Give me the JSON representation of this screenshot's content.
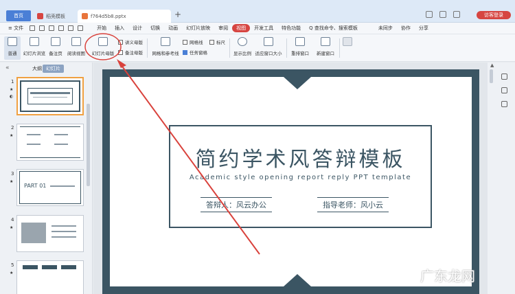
{
  "titlebar": {
    "tabs": [
      {
        "label": "首页"
      },
      {
        "label": "稻壳模板"
      },
      {
        "label": "f764d5b8.pptx"
      }
    ],
    "login_label": "访客登录"
  },
  "menubar": {
    "file_label": "≡ 文件",
    "items": [
      "开始",
      "插入",
      "设计",
      "切换",
      "动画",
      "幻灯片放映",
      "审阅",
      "视图",
      "开发工具",
      "特色功能"
    ],
    "active_item": "视图",
    "search_label": "Q 查找命令、搜索模板",
    "right_items": [
      "未同步",
      "协作",
      "分享"
    ]
  },
  "ribbon": {
    "buttons": {
      "normal": "普通",
      "slide_browse": "幻灯片浏览",
      "notes_page": "备注页",
      "reading_view": "阅读视图",
      "slide_master": "幻灯片母版",
      "grid_guides": "网格和参考线",
      "zoom": "显示比例",
      "fit_window": "适应窗口大小",
      "arrange_window": "重排窗口",
      "new_window": "新建窗口"
    },
    "small": {
      "handout_master": "讲义母版",
      "notes_master": "备注母版",
      "gridlines": "网格线",
      "ruler": "标尺",
      "task_pane": "任务窗格"
    }
  },
  "leftpanel": {
    "tab_outline": "大纲",
    "tab_slides": "幻灯片",
    "slide_numbers": [
      "1",
      "2",
      "3",
      "4",
      "5"
    ],
    "thumb3_text": "PART 01"
  },
  "slide": {
    "title": "简约学术风答辩模板",
    "subtitle": "Academic style opening report reply PPT template",
    "presenter": "答辩人：风云办公",
    "advisor": "指导老师：风小云"
  },
  "watermark": "广东龙网"
}
